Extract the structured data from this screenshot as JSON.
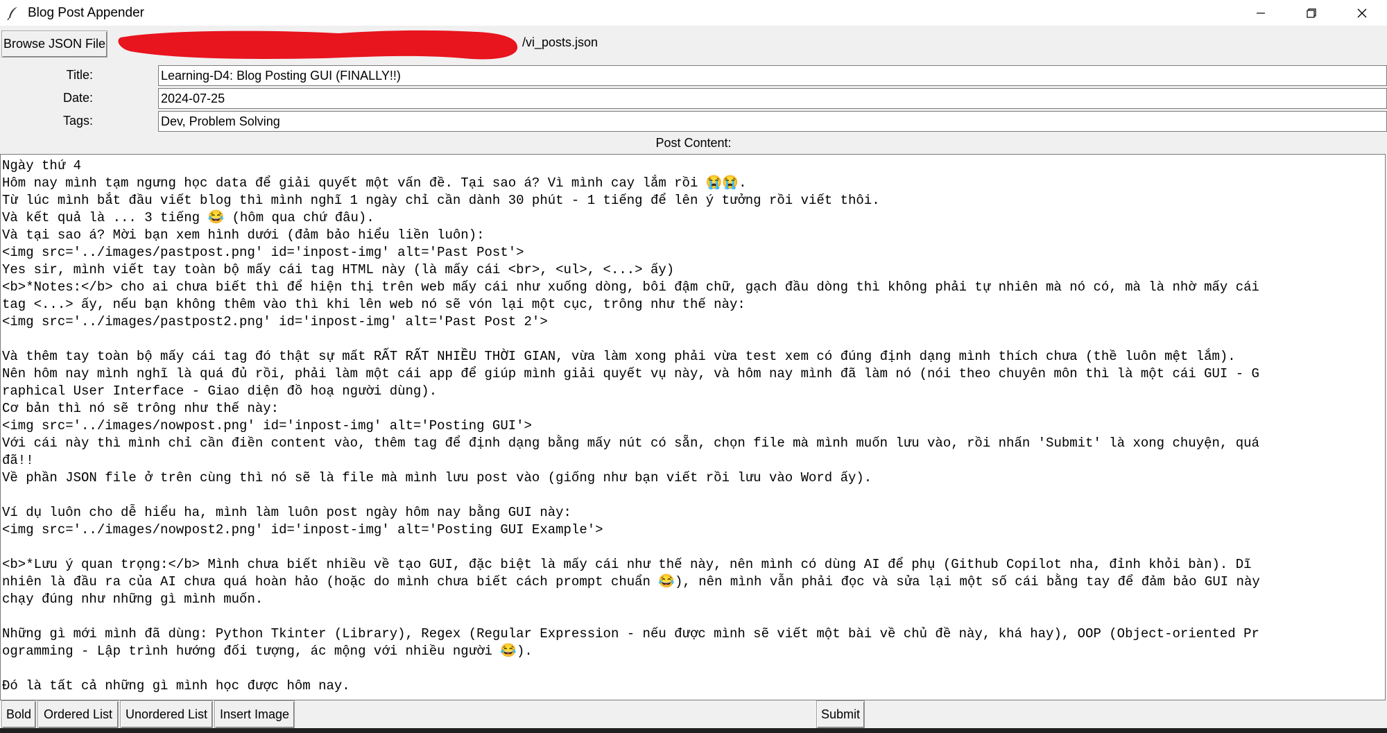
{
  "window": {
    "title": "Blog Post Appender",
    "icon": "feather-icon",
    "controls": [
      "minimize-icon",
      "restore-icon",
      "close-icon"
    ]
  },
  "file": {
    "browse_label": "Browse JSON File",
    "path_visible": "/vi_posts.json",
    "redaction_color": "#e8141e"
  },
  "form": {
    "title_label": "Title:",
    "title_value": "Learning-D4: Blog Posting GUI (FINALLY!!)",
    "date_label": "Date:",
    "date_value": "2024-07-25",
    "tags_label": "Tags:",
    "tags_value": "Dev, Problem Solving",
    "content_label": "Post Content:"
  },
  "content": {
    "lines": [
      "Ngày thứ 4",
      "Hôm nay mình tạm ngưng học data để giải quyết một vấn đề. Tại sao á? Vì mình cay lắm rồi 😭😭.",
      "Từ lúc mình bắt đầu viết blog thì mình nghĩ 1 ngày chỉ cần dành 30 phút - 1 tiếng để lên ý tưởng rồi viết thôi.",
      "Và kết quả là ... 3 tiếng 😂 (hôm qua chứ đâu).",
      "Và tại sao á? Mời bạn xem hình dưới (đảm bảo hiểu liền luôn):",
      "<img src='../images/pastpost.png' id='inpost-img' alt='Past Post'>",
      "Yes sir, mình viết tay toàn bộ mấy cái tag HTML này (là mấy cái <br>, <ul>, <...> ấy)",
      "<b>*Notes:</b> cho ai chưa biết thì để hiện thị trên web mấy cái như xuống dòng, bôi đậm chữ, gạch đầu dòng thì không phải tự nhiên mà nó có, mà là nhờ mấy cái",
      "tag <...> ấy, nếu bạn không thêm vào thì khi lên web nó sẽ vón lại một cục, trông như thế này:",
      "<img src='../images/pastpost2.png' id='inpost-img' alt='Past Post 2'>",
      "",
      "Và thêm tay toàn bộ mấy cái tag đó thật sự mất RẤT RẤT NHIỀU THỜI GIAN, vừa làm xong phải vừa test xem có đúng định dạng mình thích chưa (thề luôn mệt lắm).",
      "Nên hôm nay mình nghĩ là quá đủ rồi, phải làm một cái app để giúp mình giải quyết vụ này, và hôm nay mình đã làm nó (nói theo chuyên môn thì là một cái GUI - G",
      "raphical User Interface - Giao diện đồ hoạ người dùng).",
      "Cơ bản thì nó sẽ trông như thế này:",
      "<img src='../images/nowpost.png' id='inpost-img' alt='Posting GUI'>",
      "Với cái này thì mình chỉ cần điền content vào, thêm tag để định dạng bằng mấy nút có sẵn, chọn file mà mình muốn lưu vào, rồi nhấn 'Submit' là xong chuyện, quá",
      "đã!!",
      "Về phần JSON file ở trên cùng thì nó sẽ là file mà mình lưu post vào (giống như bạn viết rồi lưu vào Word ấy).",
      "",
      "Ví dụ luôn cho dễ hiểu ha, mình làm luôn post ngày hôm nay bằng GUI này:",
      "<img src='../images/nowpost2.png' id='inpost-img' alt='Posting GUI Example'>",
      "",
      "<b>*Lưu ý quan trọng:</b> Mình chưa biết nhiều về tạo GUI, đặc biệt là mấy cái như thế này, nên mình có dùng AI để phụ (Github Copilot nha, đỉnh khỏi bàn). Dĩ",
      "nhiên là đầu ra của AI chưa quá hoàn hảo (hoặc do mình chưa biết cách prompt chuẩn 😂), nên mình vẫn phải đọc và sửa lại một số cái bằng tay để đảm bảo GUI này",
      "chạy đúng như những gì mình muốn.",
      "",
      "Những gì mới mình đã dùng: Python Tkinter (Library), Regex (Regular Expression - nếu được mình sẽ viết một bài về chủ đề này, khá hay), OOP (Object-oriented Pr",
      "ogramming - Lập trình hướng đối tượng, ác mộng với nhiều người 😂).",
      "",
      "Đó là tất cả những gì mình học được hôm nay."
    ]
  },
  "toolbar": {
    "bold_label": "Bold",
    "ordered_label": "Ordered List",
    "unordered_label": "Unordered List",
    "insert_image_label": "Insert Image",
    "submit_label": "Submit"
  }
}
